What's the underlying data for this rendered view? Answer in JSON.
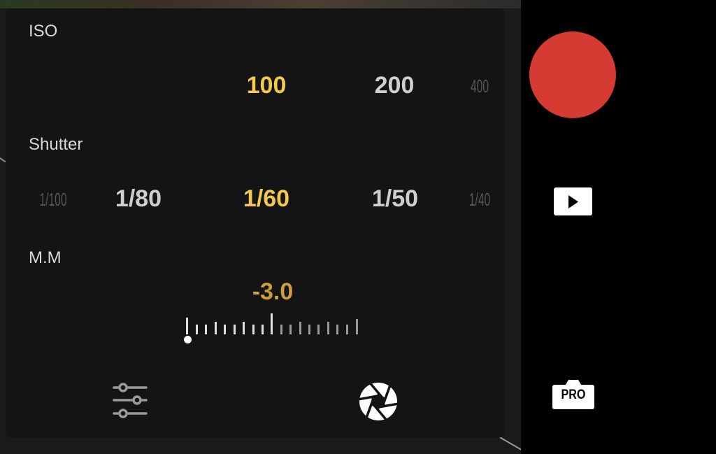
{
  "panel": {
    "iso": {
      "label": "ISO",
      "values": [
        "100",
        "200",
        "400"
      ],
      "selected": "100"
    },
    "shutter": {
      "label": "Shutter",
      "values": [
        "1/100",
        "1/80",
        "1/60",
        "1/50",
        "1/40"
      ],
      "selected": "1/60"
    },
    "mm": {
      "label": "M.M",
      "value": "-3.0"
    },
    "bottom_icons": [
      "sliders-icon",
      "aperture-icon"
    ]
  },
  "side": {
    "record_icon": "record-icon",
    "playback_icon": "play-icon",
    "pro_label": "PRO"
  },
  "colors": {
    "selected": "#f2c94c",
    "mm_value": "#c9a13a",
    "record": "#d53a33"
  }
}
